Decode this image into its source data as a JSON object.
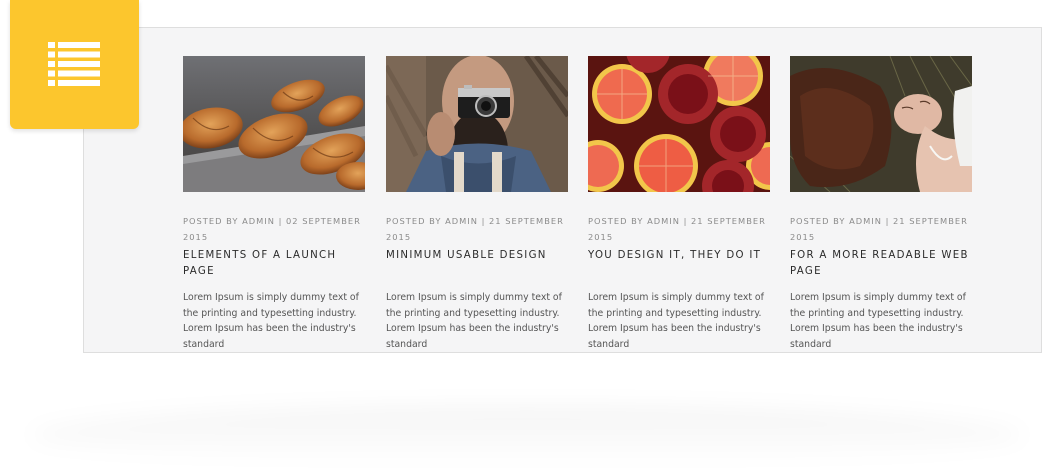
{
  "posts": [
    {
      "image": "croissants",
      "meta": "Posted by admin | 02 september 2015",
      "title": "Elements of a launch page",
      "excerpt": "Lorem Ipsum is simply dummy text of the printing and typesetting industry. Lorem Ipsum has been the industry's standard"
    },
    {
      "image": "man-with-camera",
      "meta": "Posted by admin | 21 september 2015",
      "title": "Minimum usable design",
      "excerpt": "Lorem Ipsum is simply dummy text of the printing and typesetting industry. Lorem Ipsum has been the industry's standard"
    },
    {
      "image": "grapefruit-and-pomegranates",
      "meta": "Posted by admin | 21 september 2015",
      "title": "You design it, they do it",
      "excerpt": "Lorem Ipsum is simply dummy text of the printing and typesetting industry. Lorem Ipsum has been the industry's standard"
    },
    {
      "image": "woman-lying-in-grass",
      "meta": "Posted by admin | 21 september 2015",
      "title": "For a more readable web page",
      "excerpt": "Lorem Ipsum is simply dummy text of the printing and typesetting industry. Lorem Ipsum has been the industry's standard"
    }
  ],
  "badge": {
    "icon": "list-icon",
    "color": "#fcc62d"
  }
}
